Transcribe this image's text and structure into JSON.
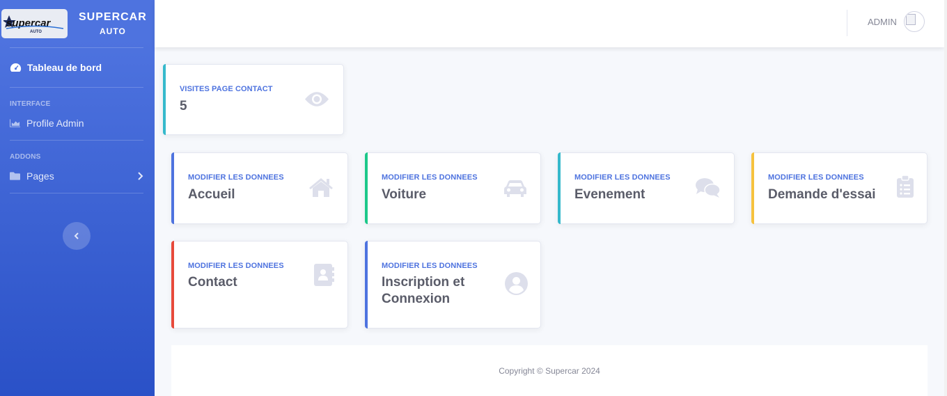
{
  "brand": {
    "logo_text": "supercar",
    "logo_sub": "AUTO",
    "title_line1": "SUPERCAR",
    "title_line2": "AUTO"
  },
  "sidebar": {
    "dashboard_label": "Tableau de bord",
    "heading_interface": "INTERFACE",
    "profile_label": "Profile Admin",
    "heading_addons": "ADDONS",
    "pages_label": "Pages"
  },
  "topbar": {
    "user_name": "ADMIN"
  },
  "stats": {
    "label": "VISITES PAGE CONTACT",
    "value": "5",
    "icon": "eye-icon"
  },
  "cards": [
    {
      "label": "MODIFIER LES DONNEES",
      "title": "Accueil",
      "accent": "#4e73df",
      "icon": "home-icon"
    },
    {
      "label": "MODIFIER LES DONNEES",
      "title": "Voiture",
      "accent": "#1cc88a",
      "icon": "car-icon"
    },
    {
      "label": "MODIFIER LES DONNEES",
      "title": "Evenement",
      "accent": "#36b9cc",
      "icon": "comments-icon"
    },
    {
      "label": "MODIFIER LES DONNEES",
      "title": "Demande d'essai",
      "accent": "#f6c23e",
      "icon": "clipboard-list-icon"
    },
    {
      "label": "MODIFIER LES DONNEES",
      "title": "Contact",
      "accent": "#e74a3b",
      "icon": "address-book-icon"
    },
    {
      "label": "MODIFIER LES DONNEES",
      "title_line1": "Inscription et",
      "title_line2": "Connexion",
      "accent": "#4e73df",
      "icon": "user-circle-icon"
    }
  ],
  "footer": {
    "copyright": "Copyright © Supercar 2024"
  },
  "colors": {
    "primary": "#4e73df",
    "success": "#1cc88a",
    "info": "#36b9cc",
    "warning": "#f6c23e",
    "danger": "#e74a3b"
  }
}
